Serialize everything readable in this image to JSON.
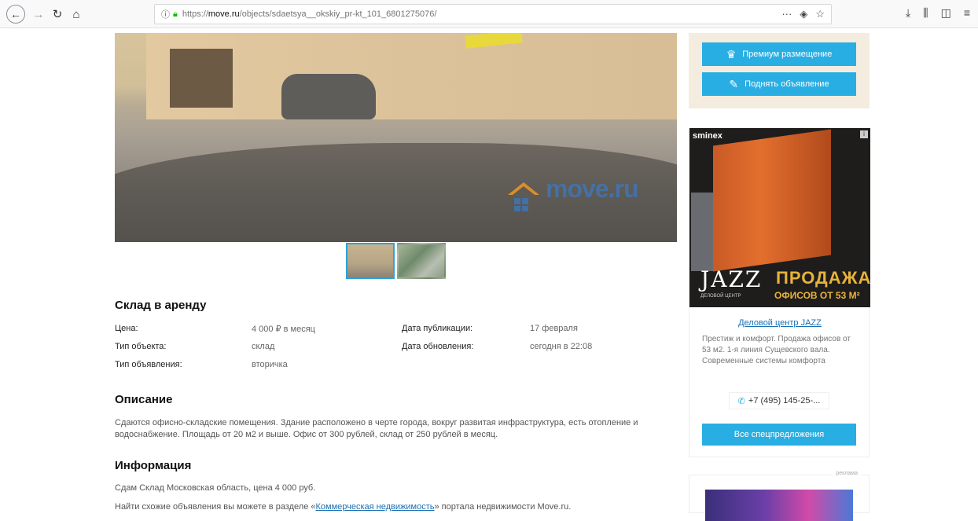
{
  "browser": {
    "url_prefix": "https://",
    "url_domain": "move.ru",
    "url_path": "/objects/sdaetsya__okskiy_pr-kt_101_6801275076/",
    "more_label": "···"
  },
  "listing": {
    "title": "Склад в аренду",
    "props": {
      "price_label": "Цена:",
      "price_value": "4 000 ₽ в месяц",
      "type_label": "Тип объекта:",
      "type_value": "склад",
      "ad_type_label": "Тип объявления:",
      "ad_type_value": "вторичка",
      "published_label": "Дата публикации:",
      "published_value": "17 февраля",
      "updated_label": "Дата обновления:",
      "updated_value": "сегодня в 22:08"
    },
    "description_heading": "Описание",
    "description_text": "Сдаются офисно-складские помещения. Здание расположено в черте города, вокруг развитая инфраструктура, есть отопление и водоснабжение. Площадь от 20 м2 и выше. Офис от 300 рублей, склад от 250 рублей в месяц.",
    "info_heading": "Информация",
    "info_line1": "Сдам Склад Московская область, цена 4 000 руб.",
    "info_line2_pre": "Найти схожие объявления вы можете в разделе «",
    "info_line2_link": "Коммерческая недвижимость",
    "info_line2_post": "» портала недвижимости Move.ru.",
    "photo_watermark": "move.ru"
  },
  "promo": {
    "premium_label": "Премиум размещение",
    "raise_label": "Поднять объявление"
  },
  "ad": {
    "brand": "sminex",
    "info_badge": "i",
    "jazz": "JAZZ",
    "jazz_sub": "ДЕЛОВОЙ ЦЕНТР",
    "sale": "ПРОДАЖА",
    "sale2": "ОФИСОВ ОТ 53 М²",
    "link": "Деловой центр JAZZ",
    "text": "Престиж и комфорт. Продажа офисов от 53 м2. 1-я линия Сущевского вала. Современные системы комфорта",
    "phone": "+7 (495) 145-25-...",
    "all_offers": "Все спецпредложения"
  },
  "ad2": {
    "label": "реклама"
  },
  "colors": {
    "accent": "#29aee3",
    "link": "#1a6fb3",
    "promo_bg": "#f4ecdf"
  }
}
